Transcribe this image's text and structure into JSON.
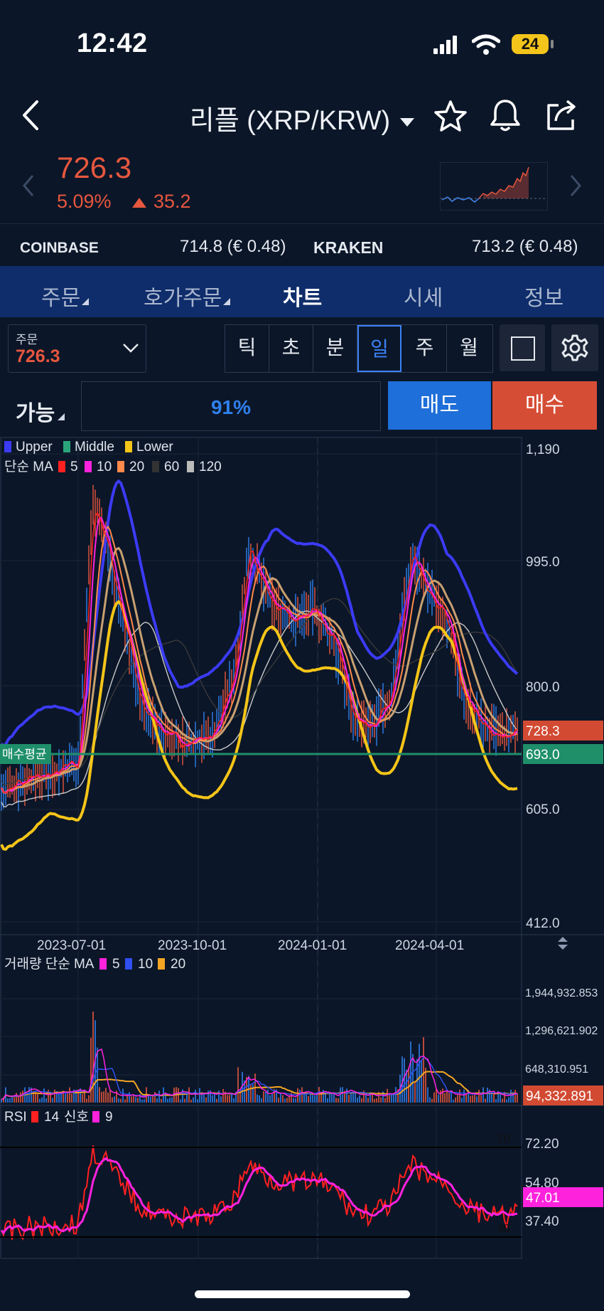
{
  "status_bar": {
    "time": "12:42",
    "battery": "24"
  },
  "header": {
    "title": "리플 (XRP/KRW)"
  },
  "price": {
    "value": "726.3",
    "change_pct": "5.09%",
    "change_abs": "35.2"
  },
  "exchanges": [
    {
      "name": "COINBASE",
      "value": "714.8 (€ 0.48)"
    },
    {
      "name": "KRAKEN",
      "value": "713.2 (€ 0.48)"
    }
  ],
  "tabs": [
    "주문",
    "호가주문",
    "차트",
    "시세",
    "정보"
  ],
  "active_tab": "차트",
  "order_field": {
    "label": "주문",
    "value": "726.3"
  },
  "periods": [
    "틱",
    "초",
    "분",
    "일",
    "주",
    "월"
  ],
  "active_period": "일",
  "available": {
    "label": "가능",
    "percent": "91%"
  },
  "actions": {
    "sell": "매도",
    "buy": "매수"
  },
  "colors": {
    "up": "#e7573e",
    "down": "#2f80ed",
    "accent": "#1e6fd9",
    "tab_bg": "#0f2d6b",
    "bg": "#0b1628"
  },
  "icons": [
    "back-icon",
    "star-icon",
    "bell-icon",
    "share-icon",
    "chevron-down-icon",
    "gear-icon"
  ],
  "chart_data": {
    "type": "line",
    "main": {
      "legend_bollinger": [
        "Upper",
        "Middle",
        "Lower"
      ],
      "legend_ma_title": "단순 MA",
      "legend_ma": [
        "5",
        "10",
        "20",
        "60",
        "120"
      ],
      "y_ticks": [
        "1,190",
        "995.0",
        "800.0",
        "605.0",
        "412.0"
      ],
      "ylim": [
        412,
        1190
      ],
      "x_ticks": [
        "2023-07-01",
        "2023-10-01",
        "2024-01-01",
        "2024-04-01"
      ],
      "last_price_label": "728.3",
      "avg_buy_label": "매수평균",
      "avg_buy_value": "693.0"
    },
    "volume": {
      "title": "거래량 단순 MA",
      "legend": [
        "5",
        "10",
        "20"
      ],
      "y_ticks": [
        "1,944,932.853",
        "1,296,621.902",
        "648,310.951"
      ],
      "last_label": "94,332.891"
    },
    "rsi": {
      "title": "RSI",
      "legend": [
        "14",
        "신호",
        "9"
      ],
      "y_ticks": [
        "72.20",
        "54.80",
        "37.40"
      ],
      "levels": [
        "70",
        "30"
      ],
      "last_label": "47.01"
    }
  }
}
